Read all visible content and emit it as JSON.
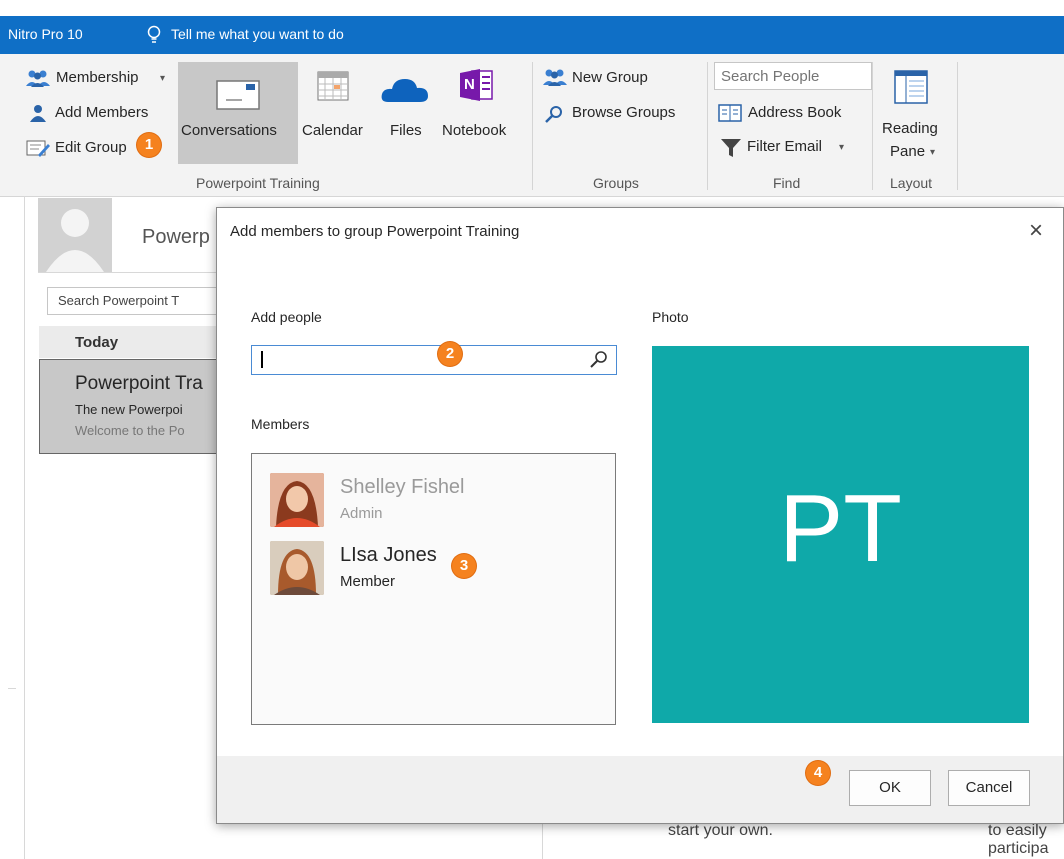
{
  "titlebar": {
    "app_name": "Nitro Pro 10",
    "tell_me": "Tell me what you want to do"
  },
  "ribbon": {
    "membership": "Membership",
    "add_members": "Add Members",
    "edit_group": "Edit Group",
    "conversations": "Conversations",
    "calendar": "Calendar",
    "files": "Files",
    "notebook": "Notebook",
    "group1_label": "Powerpoint Training",
    "new_group": "New Group",
    "browse_groups": "Browse Groups",
    "group2_label": "Groups",
    "search_people_placeholder": "Search People",
    "address_book": "Address Book",
    "filter_email": "Filter Email",
    "group3_label": "Find",
    "reading": "Reading",
    "pane": "Pane",
    "group4_label": "Layout",
    "onenote_letter": "N"
  },
  "left_pane": {
    "group_name_partial": "Powerp",
    "search_placeholder": "Search Powerpoint T",
    "today": "Today",
    "msg_title": "Powerpoint Tra",
    "msg_line1": "The new Powerpoi",
    "msg_line2": "Welcome to the Po"
  },
  "background": {
    "text1": "start your own.",
    "text2": "to easily",
    "text3": "participa"
  },
  "dialog": {
    "title": "Add members to group Powerpoint Training",
    "close": "×",
    "add_people_label": "Add people",
    "add_people_value": "",
    "members_label": "Members",
    "photo_label": "Photo",
    "photo_initials": "PT",
    "photo_color": "#0fa9a9",
    "members": [
      {
        "name": "Shelley Fishel",
        "role": "Admin"
      },
      {
        "name": "LIsa Jones",
        "role": "Member"
      }
    ],
    "ok": "OK",
    "cancel": "Cancel"
  },
  "badges": {
    "b1": "1",
    "b2": "2",
    "b3": "3",
    "b4": "4"
  }
}
